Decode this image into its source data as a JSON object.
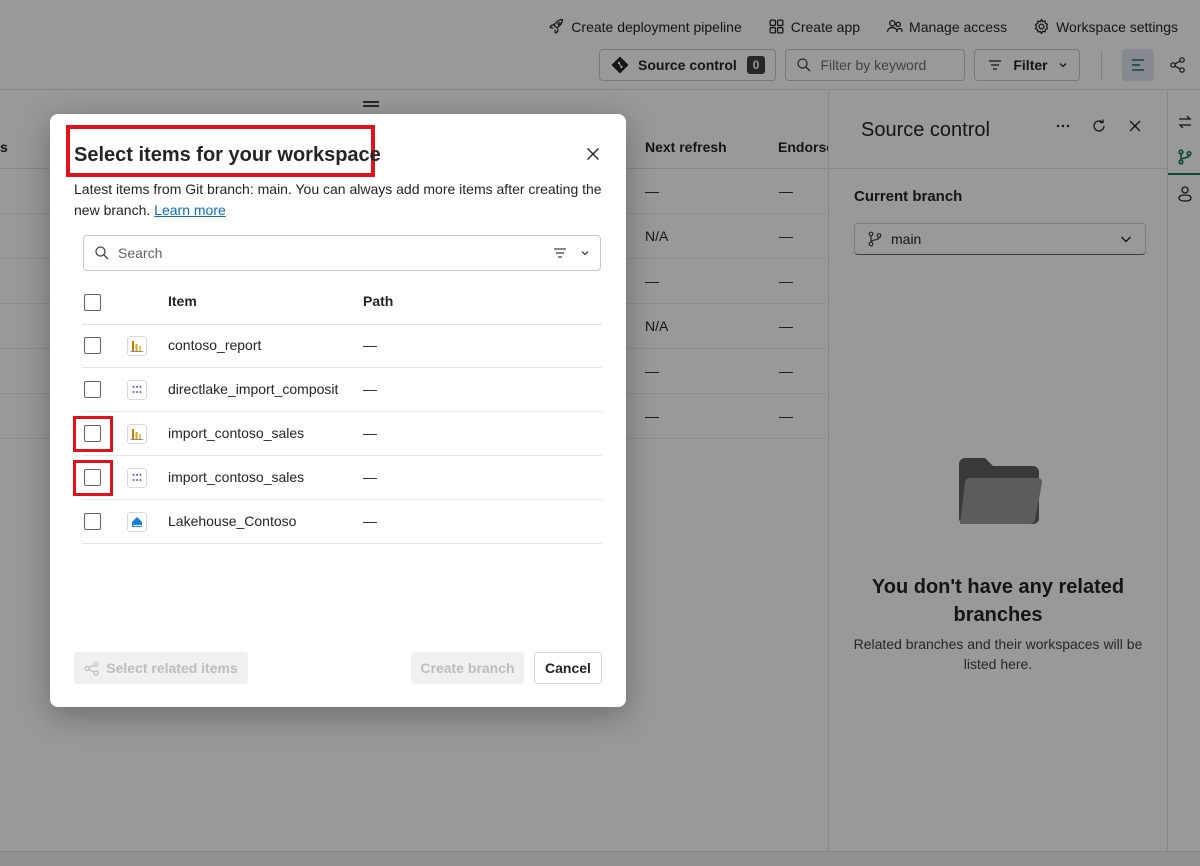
{
  "toolbar": {
    "actions": [
      {
        "label": "Create deployment pipeline",
        "icon": "rocket-icon"
      },
      {
        "label": "Create app",
        "icon": "app-icon"
      },
      {
        "label": "Manage access",
        "icon": "people-icon"
      },
      {
        "label": "Workspace settings",
        "icon": "gear-icon"
      }
    ],
    "source_control_label": "Source control",
    "source_control_count": "0",
    "filter_placeholder": "Filter by keyword",
    "filter_label": "Filter"
  },
  "background_table": {
    "partial_header": "s",
    "header_next_refresh": "Next refresh",
    "header_endorse": "Endorse",
    "rows": [
      {
        "next_refresh": "—",
        "endorse": "—"
      },
      {
        "next_refresh": "N/A",
        "endorse": "—"
      },
      {
        "next_refresh": "—",
        "endorse": "—"
      },
      {
        "next_refresh": "N/A",
        "endorse": "—"
      },
      {
        "next_refresh": "—",
        "endorse": "—"
      },
      {
        "next_refresh": "—",
        "endorse": "—"
      }
    ]
  },
  "source_control_panel": {
    "title": "Source control",
    "current_branch_label": "Current branch",
    "branch_value": "main",
    "empty_title": "You don't have any related branches",
    "empty_subtitle": "Related branches and their workspaces will be listed here."
  },
  "dialog": {
    "title": "Select items for your workspace",
    "description": "Latest items from Git branch: main. You can always add more items after creating the new branch.",
    "learn_more": "Learn more",
    "search_placeholder": "Search",
    "col_item": "Item",
    "col_path": "Path",
    "items": [
      {
        "name": "contoso_report",
        "path": "—",
        "type": "report",
        "highlighted": false
      },
      {
        "name": "directlake_import_composit",
        "path": "—",
        "type": "semantic-model",
        "highlighted": false
      },
      {
        "name": "import_contoso_sales",
        "path": "—",
        "type": "report",
        "highlighted": true
      },
      {
        "name": "import_contoso_sales",
        "path": "—",
        "type": "semantic-model",
        "highlighted": true
      },
      {
        "name": "Lakehouse_Contoso",
        "path": "—",
        "type": "lakehouse",
        "highlighted": false
      }
    ],
    "select_related_label": "Select related items",
    "create_branch_label": "Create branch",
    "cancel_label": "Cancel"
  },
  "colors": {
    "accent": "#117865",
    "highlight": "#e0121b",
    "overlay": "rgba(0,0,0,0.40)"
  }
}
